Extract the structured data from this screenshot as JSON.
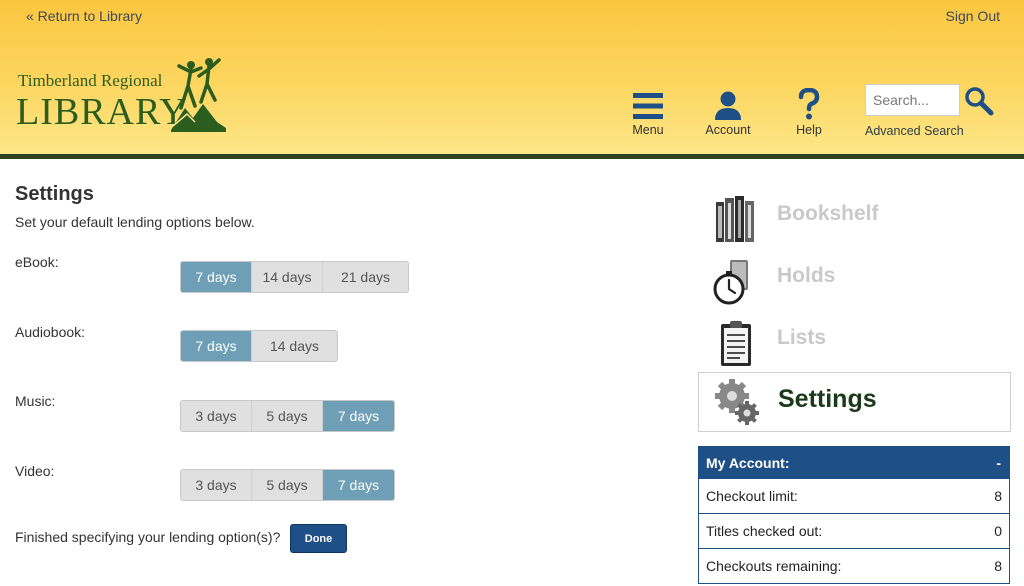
{
  "header": {
    "return_link": "« Return to Library",
    "signout_link": "Sign Out",
    "logo_top": "Timberland Regional",
    "logo_main": "LIBRARY",
    "nav": {
      "menu": "Menu",
      "account": "Account",
      "help": "Help"
    },
    "search_placeholder": "Search...",
    "advanced_search": "Advanced Search"
  },
  "main": {
    "title": "Settings",
    "subtitle": "Set your default lending options below.",
    "ebook": {
      "label": "eBook:",
      "options": [
        "7 days",
        "14 days",
        "21 days"
      ],
      "selected": "7 days"
    },
    "audiobook": {
      "label": "Audiobook:",
      "options": [
        "7 days",
        "14 days"
      ],
      "selected": "7 days"
    },
    "music": {
      "label": "Music:",
      "options": [
        "3 days",
        "5 days",
        "7 days"
      ],
      "selected": "7 days"
    },
    "video": {
      "label": "Video:",
      "options": [
        "3 days",
        "5 days",
        "7 days"
      ],
      "selected": "7 days"
    },
    "finish_text": "Finished specifying your lending option(s)?",
    "done_label": "Done"
  },
  "sidebar": {
    "items": [
      {
        "label": "Bookshelf",
        "icon": "bookshelf-icon"
      },
      {
        "label": "Holds",
        "icon": "stopwatch-icon"
      },
      {
        "label": "Lists",
        "icon": "clipboard-icon"
      },
      {
        "label": "Settings",
        "icon": "gears-icon",
        "active": true
      }
    ],
    "account": {
      "title": "My Account:",
      "toggle": "-",
      "rows": [
        {
          "label": "Checkout limit:",
          "value": "8"
        },
        {
          "label": "Titles checked out:",
          "value": "0"
        },
        {
          "label": "Checkouts remaining:",
          "value": "8"
        }
      ]
    }
  },
  "colors": {
    "header_yellow": "#fcd660",
    "header_rule": "#2f4220",
    "selected_option": "#6f9fb6",
    "primary_blue": "#1e4f86",
    "logo_green": "#2b5d1f"
  }
}
